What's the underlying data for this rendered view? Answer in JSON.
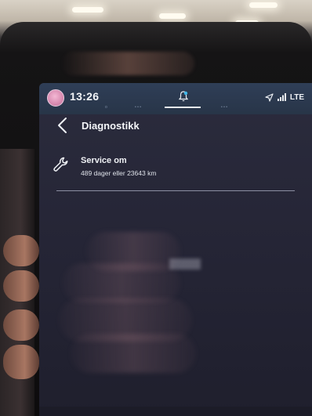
{
  "statusbar": {
    "time": "13:26",
    "network": "LTE",
    "avatar_icon": "profile-avatar",
    "notification_icon": "bell-icon",
    "location_icon": "location-arrow-icon",
    "signal_icon": "signal-bars-icon"
  },
  "header": {
    "title": "Diagnostikk",
    "back_icon": "chevron-left-icon"
  },
  "service_row": {
    "icon": "wrench-icon",
    "title": "Service om",
    "detail": "489 dager eller 23643 km"
  },
  "colors": {
    "statusbar_bg": "#2f3e57",
    "screen_bg": "#262637",
    "text": "#f4f5f8",
    "avatar_accent": "#d88ab0"
  }
}
